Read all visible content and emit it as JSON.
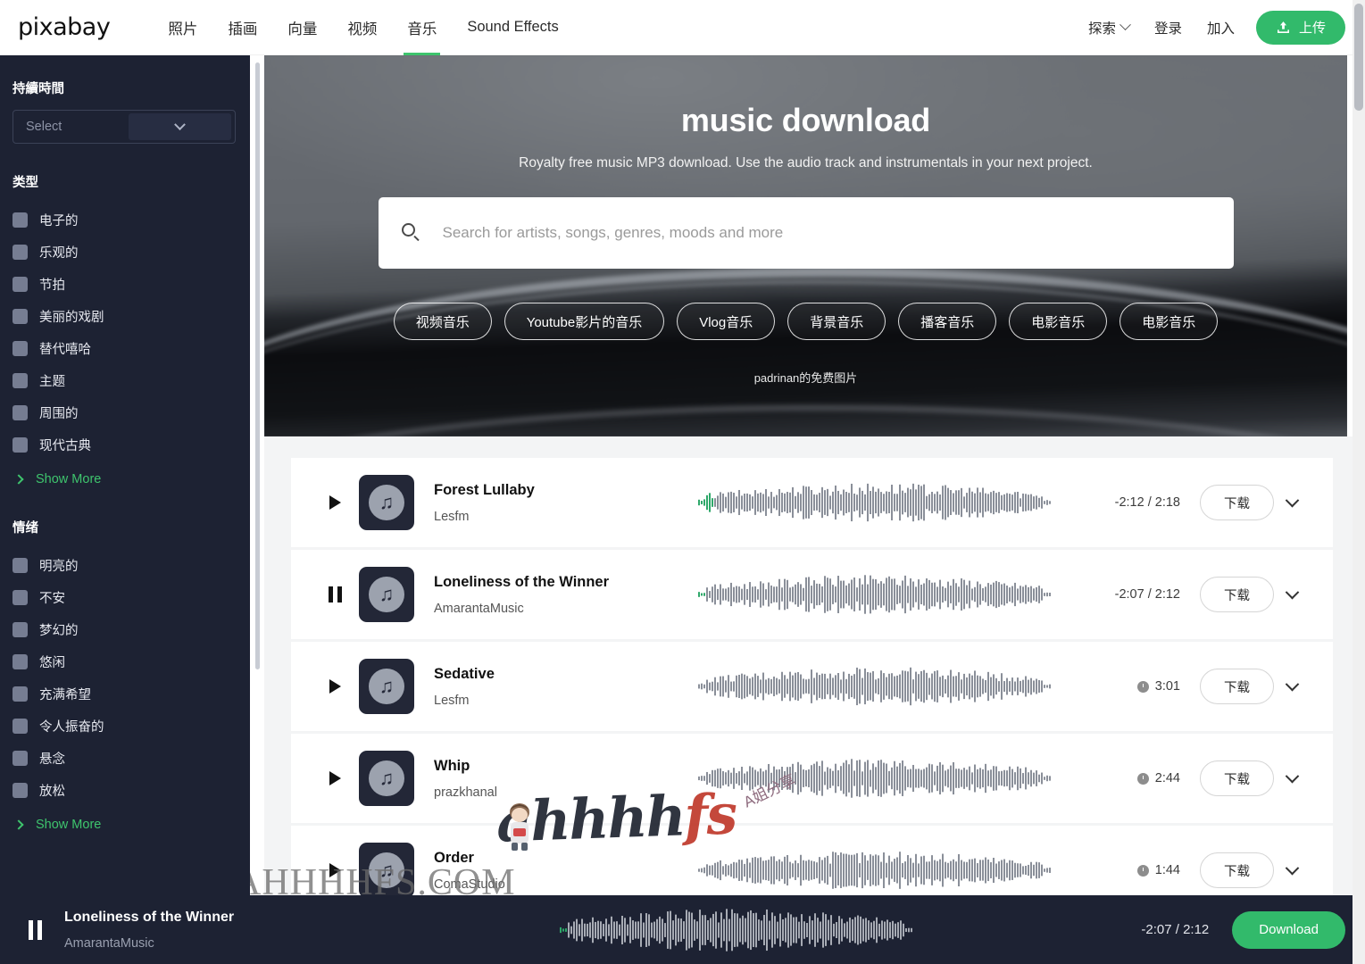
{
  "header": {
    "logo": "pixabay",
    "nav": [
      {
        "label": "照片",
        "active": false
      },
      {
        "label": "插画",
        "active": false
      },
      {
        "label": "向量",
        "active": false
      },
      {
        "label": "视频",
        "active": false
      },
      {
        "label": "音乐",
        "active": true
      },
      {
        "label": "Sound Effects",
        "active": false
      }
    ],
    "explore_label": "探索",
    "login_label": "登录",
    "join_label": "加入",
    "upload_label": "上传",
    "accent_color": "#32ba6b"
  },
  "sidebar": {
    "duration_title": "持續時間",
    "duration_select_placeholder": "Select",
    "genre_title": "类型",
    "genre_items": [
      "电子的",
      "乐观的",
      "节拍",
      "美丽的戏剧",
      "替代嘻哈",
      "主题",
      "周围的",
      "现代古典"
    ],
    "genre_show_more": "Show More",
    "mood_title": "情绪",
    "mood_items": [
      "明亮的",
      "不安",
      "梦幻的",
      "悠闲",
      "充满希望",
      "令人振奋的",
      "悬念",
      "放松"
    ],
    "mood_show_more": "Show More"
  },
  "hero": {
    "title": "music download",
    "subtitle": "Royalty free music MP3 download. Use the audio track and instrumentals in your next project.",
    "search_placeholder": "Search for artists, songs, genres, moods and more",
    "tags": [
      "视频音乐",
      "Youtube影片的音乐",
      "Vlog音乐",
      "背景音乐",
      "播客音乐",
      "电影音乐",
      "电影音乐"
    ],
    "credit": "padrinan的免费图片"
  },
  "tracks": [
    {
      "title": "Forest Lullaby",
      "artist": "Lesfm",
      "time": "-2:12 / 2:18",
      "state": "playing_paused_head",
      "playing": false,
      "progress": 4,
      "download_label": "下载",
      "has_clock": false
    },
    {
      "title": "Loneliness of the Winner",
      "artist": "AmarantaMusic",
      "time": "-2:07 / 2:12",
      "state": "paused",
      "playing": true,
      "progress": 2,
      "download_label": "下载",
      "has_clock": false
    },
    {
      "title": "Sedative",
      "artist": "Lesfm",
      "time": "3:01",
      "state": "idle",
      "playing": false,
      "progress": 0,
      "download_label": "下载",
      "has_clock": true
    },
    {
      "title": "Whip",
      "artist": "prazkhanal",
      "time": "2:44",
      "state": "idle",
      "playing": false,
      "progress": 0,
      "download_label": "下载",
      "has_clock": true
    },
    {
      "title": "Order",
      "artist": "ComaStudio",
      "time": "1:44",
      "state": "idle",
      "playing": false,
      "progress": 0,
      "download_label": "下载",
      "has_clock": true
    }
  ],
  "player": {
    "title": "Loneliness of the Winner",
    "artist": "AmarantaMusic",
    "time": "-2:07 / 2:12",
    "download_label": "Download",
    "progress": 2
  },
  "watermark": {
    "main": "ahhhhfs",
    "domain": "AHHHHFS.COM",
    "small": "A姐分享"
  }
}
